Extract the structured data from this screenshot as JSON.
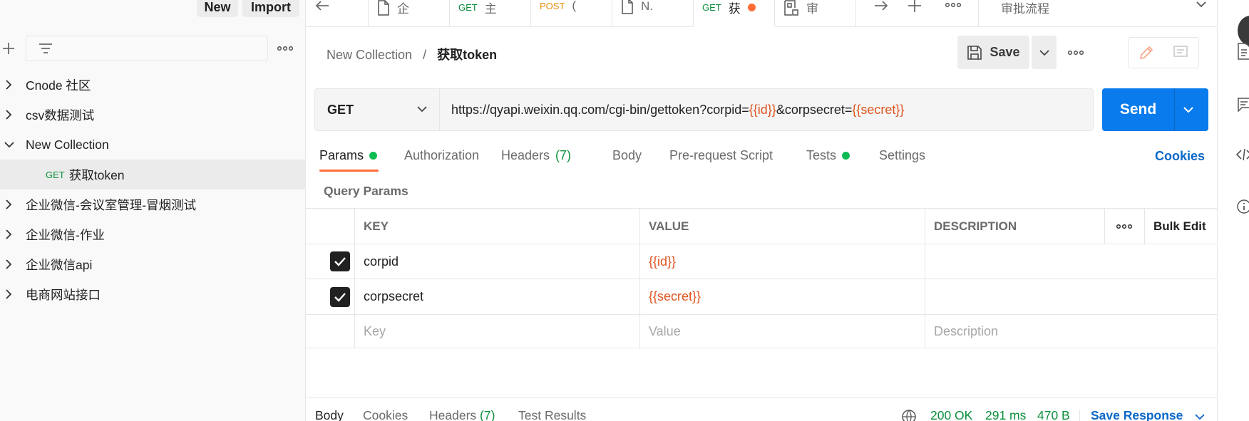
{
  "sidebar": {
    "new_label": "New",
    "import_label": "Import",
    "items": [
      {
        "label": "Cnode 社区",
        "expanded": false
      },
      {
        "label": "csv数据测试",
        "expanded": false
      },
      {
        "label": "New Collection",
        "expanded": true
      },
      {
        "method": "GET",
        "label": "获取token",
        "selected": true
      },
      {
        "label": "企业微信-会议室管理-冒烟测试",
        "expanded": false
      },
      {
        "label": "企业微信-作业",
        "expanded": false
      },
      {
        "label": "企业微信api",
        "expanded": false
      },
      {
        "label": "电商网站接口",
        "expanded": false
      }
    ]
  },
  "tabs": [
    {
      "icon": "document-icon",
      "label": "企"
    },
    {
      "method": "GET",
      "label": "主"
    },
    {
      "method": "POST",
      "label": "("
    },
    {
      "icon": "document-icon",
      "label": "N."
    },
    {
      "method": "GET",
      "label": "获",
      "active": true,
      "unsaved": true
    },
    {
      "icon": "grid-doc-icon",
      "label": "审"
    }
  ],
  "environment": {
    "label": "审批流程"
  },
  "breadcrumb": {
    "parent": "New Collection",
    "separator": "/",
    "current": "获取token"
  },
  "toolbar": {
    "save_label": "Save"
  },
  "request": {
    "method": "GET",
    "url_parts": [
      {
        "text": "https://qyapi.weixin.qq.com/cgi-bin/gettoken?corpid=",
        "var": false
      },
      {
        "text": "{{id}}",
        "var": true
      },
      {
        "text": "&corpsecret=",
        "var": false
      },
      {
        "text": "{{secret}}",
        "var": true
      }
    ],
    "send_label": "Send"
  },
  "request_tabs": {
    "params": "Params",
    "authorization": "Authorization",
    "headers": "Headers",
    "headers_count": "(7)",
    "body": "Body",
    "pre_request": "Pre-request Script",
    "tests": "Tests",
    "settings": "Settings",
    "cookies": "Cookies"
  },
  "query_params": {
    "title": "Query Params",
    "headers": {
      "key": "KEY",
      "value": "VALUE",
      "description": "DESCRIPTION",
      "bulk_edit": "Bulk Edit"
    },
    "rows": [
      {
        "key": "corpid",
        "value": "{{id}}",
        "checked": true
      },
      {
        "key": "corpsecret",
        "value": "{{secret}}",
        "checked": true
      }
    ],
    "placeholders": {
      "key": "Key",
      "value": "Value",
      "description": "Description"
    }
  },
  "response": {
    "tabs": {
      "body": "Body",
      "cookies": "Cookies",
      "headers": "Headers",
      "headers_count": "(7)",
      "test_results": "Test Results"
    },
    "status": "200 OK",
    "time": "291 ms",
    "size": "470 B",
    "save_label": "Save Response"
  },
  "colors": {
    "accent": "#ff6c37",
    "send": "#097bed",
    "get": "#0b8f3c",
    "post": "#e58d0b",
    "variable": "#e0541e",
    "link": "#0a68c8"
  }
}
